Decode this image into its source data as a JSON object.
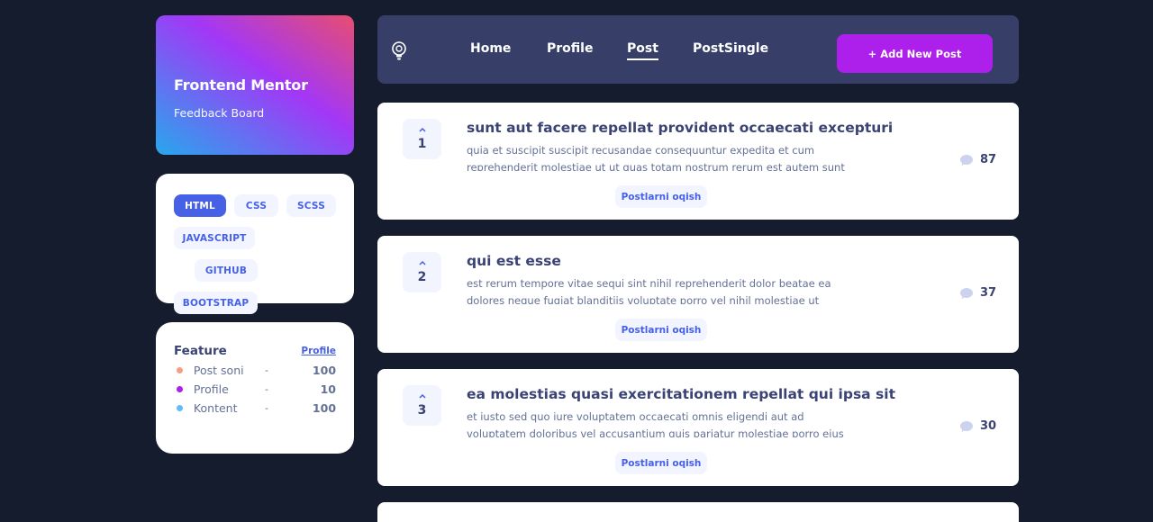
{
  "brand": {
    "title": "Frontend Mentor",
    "subtitle": "Feedback Board"
  },
  "tags": [
    "HTML",
    "CSS",
    "SCSS",
    "JAVASCRIPT",
    "GITHUB",
    "BOOTSTRAP"
  ],
  "active_tag": "HTML",
  "feature": {
    "title": "Feature",
    "link": "Profile",
    "rows": [
      {
        "label": "Post soni",
        "sep": "-",
        "value": "100",
        "color": "#f49f85"
      },
      {
        "label": "Profile",
        "sep": "-",
        "value": "10",
        "color": "#ad1fea"
      },
      {
        "label": "Kontent",
        "sep": "-",
        "value": "100",
        "color": "#62bcfa"
      }
    ]
  },
  "nav": {
    "icon": "lightbulb-icon",
    "links": [
      "Home",
      "Profile",
      "Post",
      "PostSingle"
    ],
    "active": "Post",
    "add_button": "+ Add New Post"
  },
  "posts": [
    {
      "votes": "1",
      "title": "sunt aut facere repellat provident occaecati excepturi",
      "body": "quia et suscipit suscipit recusandae consequuntur expedita et cum reprehenderit molestiae ut ut quas totam nostrum rerum est autem sunt rem",
      "button": "Postlarni oqish",
      "comments": "87"
    },
    {
      "votes": "2",
      "title": "qui est esse",
      "body": "est rerum tempore vitae sequi sint nihil reprehenderit dolor beatae ea dolores neque fugiat blanditiis voluptate porro vel nihil molestiae ut reiciendis qui",
      "button": "Postlarni oqish",
      "comments": "37"
    },
    {
      "votes": "3",
      "title": "ea molestias quasi exercitationem repellat qui ipsa sit",
      "body": "et iusto sed quo iure voluptatem occaecati omnis eligendi aut ad voluptatem doloribus vel accusantium quis pariatur molestiae porro eius odio et labore et",
      "button": "Postlarni oqish",
      "comments": "30"
    }
  ],
  "colors": {
    "background": "#151c2e",
    "nav": "#373f68",
    "accent_purple": "#ad1fea",
    "accent_blue": "#4661e6",
    "text_dark": "#3a4374"
  }
}
